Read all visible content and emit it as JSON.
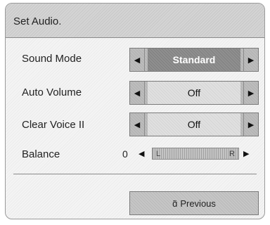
{
  "header": {
    "title": "Set Audio."
  },
  "rows": [
    {
      "label": "Sound Mode",
      "value": "Standard"
    },
    {
      "label": "Auto Volume",
      "value": "Off"
    },
    {
      "label": "Clear Voice II",
      "value": "Off"
    }
  ],
  "balance": {
    "label": "Balance",
    "value": "0",
    "left_label": "L",
    "right_label": "R",
    "level": 0.5
  },
  "arrows": {
    "left": "◀",
    "right": "▶"
  },
  "footer": {
    "previous_label": "Previous",
    "previous_icon": "ɑ̃"
  }
}
